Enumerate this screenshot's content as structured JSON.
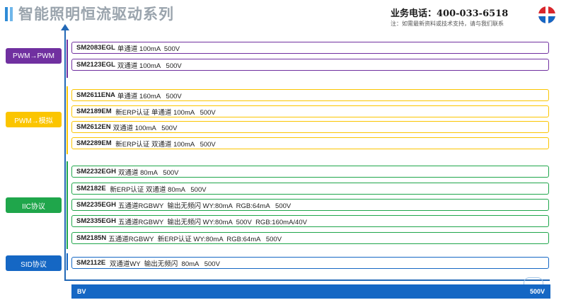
{
  "header": {
    "title": "智能照明恒流驱动系列",
    "phone": "业务电话：400-033-6518",
    "note": "注：如需最新资料或技术支持，请与我们联系"
  },
  "colors": {
    "purple": "#7030a0",
    "yellow": "#fbc500",
    "green": "#1fa64b",
    "blue": "#1567c4",
    "axis": "#2268b6"
  },
  "categories": [
    {
      "label": "PWM→PWM",
      "color": "#7030a0"
    },
    {
      "label": "PWM→模拟",
      "color": "#fbc500"
    },
    {
      "label": "IIC协议",
      "color": "#1fa64b"
    },
    {
      "label": "SID协议",
      "color": "#1567c4"
    }
  ],
  "products": [
    {
      "model": "SM2083EGL",
      "spec": "单通道 100mA  500V"
    },
    {
      "model": "SM2123EGL",
      "spec": "双通道 100mA   500V"
    },
    {
      "model": "SM2611ENA",
      "spec": "单通道 160mA   500V"
    },
    {
      "model": "SM2189EM",
      "spec": " 新ERP认证 单通道 100mA   500V"
    },
    {
      "model": "SM2612EN",
      "spec": "双通道 100mA   500V"
    },
    {
      "model": "SM2289EM",
      "spec": " 新ERP认证 双通道 100mA   500V"
    },
    {
      "model": "SM2232EGH",
      "spec": "双通道 80mA   500V"
    },
    {
      "model": "SM2182E",
      "spec": " 新ERP认证 双通道 80mA   500V"
    },
    {
      "model": "SM2235EGH",
      "spec": "五通道RGBWY  输出无频闪 WY:80mA  RGB:64mA   500V"
    },
    {
      "model": "SM2335EGH",
      "spec": "五通道RGBWY  输出无频闪 WY:80mA  500V  RGB:160mA/40V"
    },
    {
      "model": "SM2185N",
      "spec": "五通道RGBWY  新ERP认证 WY:80mA  RGB:64mA   500V"
    },
    {
      "model": "SM2112E",
      "spec": " 双通道WY  输出无频闪  80mA   500V"
    }
  ],
  "bar": {
    "left": "BV",
    "right": "500V"
  }
}
